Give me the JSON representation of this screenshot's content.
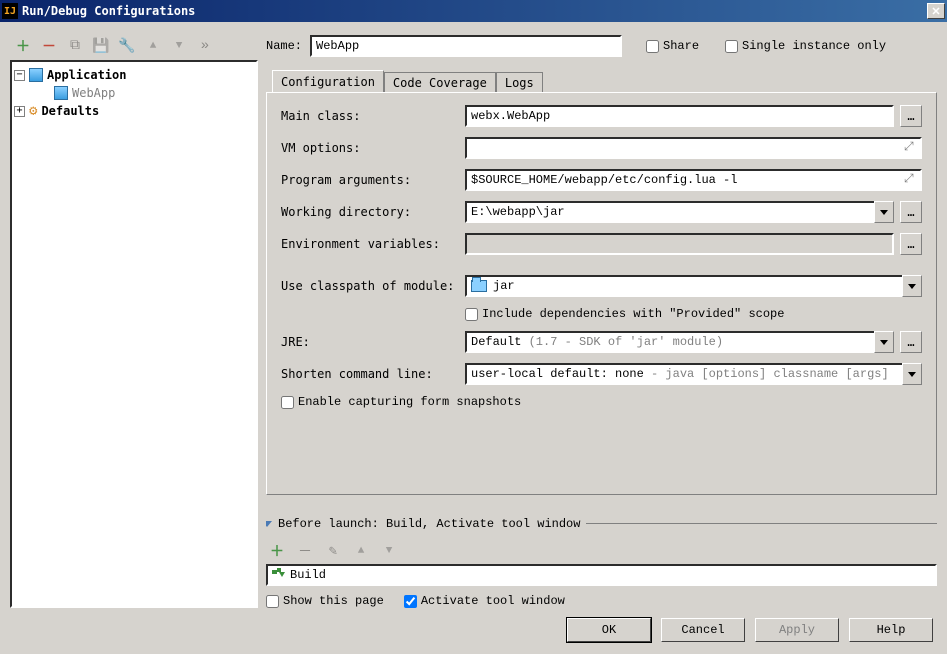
{
  "window": {
    "title": "Run/Debug Configurations"
  },
  "tree": {
    "app_node": "Application",
    "app_child": "WebApp",
    "defaults_node": "Defaults"
  },
  "header": {
    "name_label": "Name:",
    "name_value": "WebApp",
    "share_label": "Share",
    "single_instance_label": "Single instance only"
  },
  "tabs": {
    "configuration": "Configuration",
    "code_coverage": "Code Coverage",
    "logs": "Logs"
  },
  "form": {
    "main_class_label": "Main class:",
    "main_class_value": "webx.WebApp",
    "vm_options_label": "VM options:",
    "vm_options_value": "",
    "program_args_label": "Program arguments:",
    "program_args_value": "$SOURCE_HOME/webapp/etc/config.lua -l",
    "working_dir_label": "Working directory:",
    "working_dir_value": "E:\\webapp\\jar",
    "env_vars_label": "Environment variables:",
    "env_vars_value": "",
    "classpath_label": "Use classpath of module:",
    "classpath_value": "jar",
    "include_provided_label": "Include dependencies with \"Provided\" scope",
    "jre_label": "JRE:",
    "jre_value_prefix": "Default ",
    "jre_value_suffix": "(1.7 - SDK of 'jar' module)",
    "shorten_label": "Shorten command line:",
    "shorten_value_prefix": "user-local default: none ",
    "shorten_value_suffix": "- java [options] classname [args]",
    "enable_snapshots_label": "Enable capturing form snapshots"
  },
  "before_launch": {
    "legend": "Before launch: Build, Activate tool window",
    "item": "Build",
    "show_page": "Show this page",
    "activate_window": "Activate tool window"
  },
  "footer": {
    "ok": "OK",
    "cancel": "Cancel",
    "apply": "Apply",
    "help": "Help"
  }
}
